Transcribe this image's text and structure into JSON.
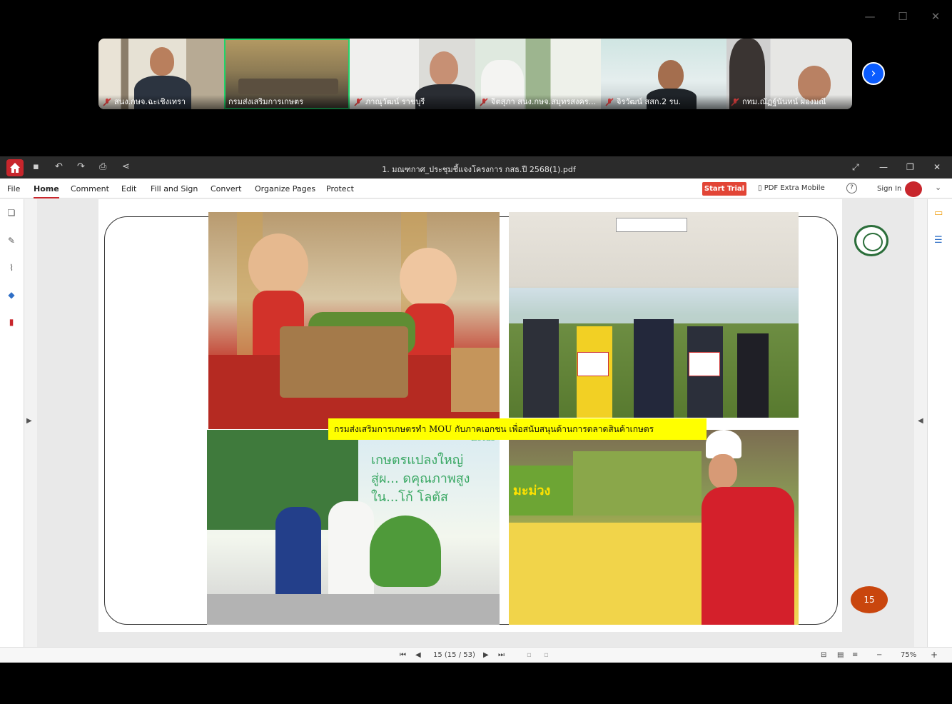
{
  "meeting": {
    "window_controls": [
      "—",
      "☐",
      "✕"
    ],
    "participants": [
      {
        "name": "สนง.กษจ.ฉะเชิงเทรา",
        "muted": true
      },
      {
        "name": "กรมส่งเสริมการเกษตร",
        "muted": false
      },
      {
        "name": "ภาณุวัฒน์ ราชบุรี",
        "muted": true
      },
      {
        "name": "จิตสุภา สนง.กษจ.สมุทรสงคร...",
        "muted": true
      },
      {
        "name": "จิรวัฒน์ สสก.2 รบ.",
        "muted": true
      },
      {
        "name": "กทม.ณัฏฐ์นันทน์ ผ่องมณี",
        "muted": true
      }
    ],
    "next_icon": "›"
  },
  "app": {
    "document_title": "1. มณฑกาศ_ประชุมชี้แจงโครงการ กสธ.ปี 2568(1).pdf",
    "menus": [
      "File",
      "Home",
      "Comment",
      "Edit",
      "Fill and Sign",
      "Convert",
      "Organize Pages",
      "Protect"
    ],
    "selected_menu": "Home",
    "start_trial": "Start Trial",
    "pdf_extra_mobile": "PDF Extra Mobile",
    "help": "?",
    "sign_in": "Sign In",
    "accent": "#c8262c"
  },
  "slide": {
    "caption": "กรมส่งเสริมการเกษตรทำ MOU กับภาคเอกชน เพื่อสนับสนุนด้านการตลาดสินค้าเกษตร",
    "page_badge": "15",
    "photo3_banner_lines": [
      "เกษตรแปลงใหญ่",
      "สู่ผ... ดคุณภาพสูง",
      "ใน...โก้ โลตัส"
    ],
    "photo3_brand": "Lotus",
    "photo4_sign": "มะม่วง"
  },
  "statusbar": {
    "page_indicator": "15 (15 / 53)",
    "zoom": "75%",
    "zoom_out": "−",
    "zoom_in": "+"
  }
}
